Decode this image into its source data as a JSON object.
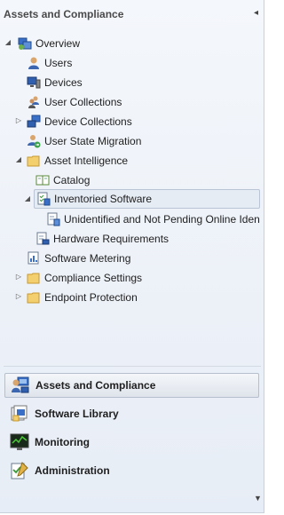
{
  "workspace_title": "Assets and Compliance",
  "tree": {
    "overview": "Overview",
    "users": "Users",
    "devices": "Devices",
    "user_collections": "User Collections",
    "device_collections": "Device Collections",
    "user_state_migration": "User State Migration",
    "asset_intelligence": "Asset Intelligence",
    "catalog": "Catalog",
    "inventoried_software": "Inventoried Software",
    "unidentified": "Unidentified and Not Pending Online Iden",
    "hardware_requirements": "Hardware Requirements",
    "software_metering": "Software Metering",
    "compliance_settings": "Compliance Settings",
    "endpoint_protection": "Endpoint Protection"
  },
  "workspaces": {
    "assets": "Assets and Compliance",
    "software_library": "Software Library",
    "monitoring": "Monitoring",
    "administration": "Administration"
  },
  "icons": {
    "collapse": "chevron-left-icon",
    "expanded": "triangle-down-icon",
    "collapsed": "triangle-right-icon",
    "scroll_down": "triangle-down-icon"
  },
  "colors": {
    "pane_bg": "#e9eef6",
    "selection": "#e6ecf4",
    "folder": "#f3cf6e"
  }
}
